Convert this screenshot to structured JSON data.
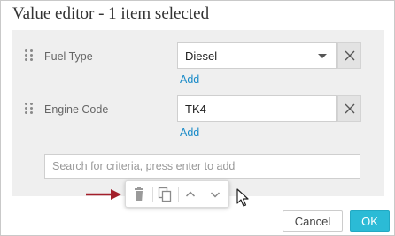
{
  "dialog": {
    "title": "Value editor - 1 item selected"
  },
  "criteria": [
    {
      "label": "Fuel Type",
      "value": "Diesel",
      "has_dropdown": true,
      "add_label": "Add"
    },
    {
      "label": "Engine Code",
      "value": "TK4",
      "has_dropdown": false,
      "add_label": "Add"
    }
  ],
  "search": {
    "placeholder": "Search for criteria, press enter to add"
  },
  "toolbar": {
    "icons": [
      "trash-icon",
      "copy-icon",
      "chevron-up-icon",
      "chevron-down-icon"
    ]
  },
  "footer": {
    "cancel_label": "Cancel",
    "ok_label": "OK"
  },
  "colors": {
    "accent": "#2bbbd6",
    "link": "#1a8bc8",
    "panel": "#efefef",
    "annotation_arrow": "#a31f2a"
  }
}
